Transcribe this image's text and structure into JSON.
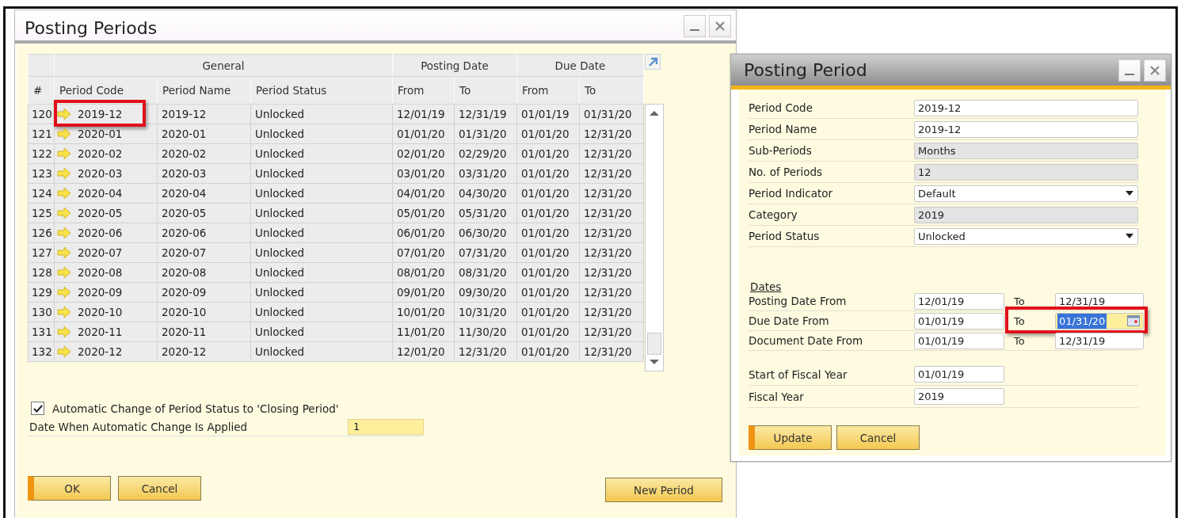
{
  "posting_periods": {
    "title": "Posting Periods",
    "table": {
      "number_column": "#",
      "column_groups": [
        {
          "label": "General",
          "columns": [
            "Period Code",
            "Period Name",
            "Period Status"
          ]
        },
        {
          "label": "Posting Date",
          "columns": [
            "From",
            "To"
          ]
        },
        {
          "label": "Due Date",
          "columns": [
            "From",
            "To"
          ]
        }
      ],
      "rows": [
        {
          "number": "120",
          "cells": [
            "2019-12",
            "2019-12",
            "Unlocked",
            "12/01/19",
            "12/31/19",
            "01/01/19",
            "01/31/20"
          ],
          "highlighted": true
        },
        {
          "number": "121",
          "cells": [
            "2020-01",
            "2020-01",
            "Unlocked",
            "01/01/20",
            "01/31/20",
            "01/01/20",
            "12/31/20"
          ],
          "highlighted": false
        },
        {
          "number": "122",
          "cells": [
            "2020-02",
            "2020-02",
            "Unlocked",
            "02/01/20",
            "02/29/20",
            "01/01/20",
            "12/31/20"
          ],
          "highlighted": false
        },
        {
          "number": "123",
          "cells": [
            "2020-03",
            "2020-03",
            "Unlocked",
            "03/01/20",
            "03/31/20",
            "01/01/20",
            "12/31/20"
          ],
          "highlighted": false
        },
        {
          "number": "124",
          "cells": [
            "2020-04",
            "2020-04",
            "Unlocked",
            "04/01/20",
            "04/30/20",
            "01/01/20",
            "12/31/20"
          ],
          "highlighted": false
        },
        {
          "number": "125",
          "cells": [
            "2020-05",
            "2020-05",
            "Unlocked",
            "05/01/20",
            "05/31/20",
            "01/01/20",
            "12/31/20"
          ],
          "highlighted": false
        },
        {
          "number": "126",
          "cells": [
            "2020-06",
            "2020-06",
            "Unlocked",
            "06/01/20",
            "06/30/20",
            "01/01/20",
            "12/31/20"
          ],
          "highlighted": false
        },
        {
          "number": "127",
          "cells": [
            "2020-07",
            "2020-07",
            "Unlocked",
            "07/01/20",
            "07/31/20",
            "01/01/20",
            "12/31/20"
          ],
          "highlighted": false
        },
        {
          "number": "128",
          "cells": [
            "2020-08",
            "2020-08",
            "Unlocked",
            "08/01/20",
            "08/31/20",
            "01/01/20",
            "12/31/20"
          ],
          "highlighted": false
        },
        {
          "number": "129",
          "cells": [
            "2020-09",
            "2020-09",
            "Unlocked",
            "09/01/20",
            "09/30/20",
            "01/01/20",
            "12/31/20"
          ],
          "highlighted": false
        },
        {
          "number": "130",
          "cells": [
            "2020-10",
            "2020-10",
            "Unlocked",
            "10/01/20",
            "10/31/20",
            "01/01/20",
            "12/31/20"
          ],
          "highlighted": false
        },
        {
          "number": "131",
          "cells": [
            "2020-11",
            "2020-11",
            "Unlocked",
            "11/01/20",
            "11/30/20",
            "01/01/20",
            "12/31/20"
          ],
          "highlighted": false
        },
        {
          "number": "132",
          "cells": [
            "2020-12",
            "2020-12",
            "Unlocked",
            "12/01/20",
            "12/31/20",
            "01/01/20",
            "12/31/20"
          ],
          "highlighted": false
        }
      ]
    },
    "auto_change": {
      "label": "Automatic Change of Period Status to 'Closing Period'",
      "checked": true
    },
    "apply_date": {
      "label": "Date When Automatic Change Is Applied",
      "value": "1"
    },
    "buttons": [
      {
        "label": "OK",
        "default": true
      },
      {
        "label": "Cancel",
        "default": false
      }
    ],
    "side_buttons": [
      {
        "label": "New Period",
        "default": false
      }
    ]
  },
  "posting_period": {
    "title": "Posting Period",
    "fields": [
      {
        "label": "Period Code",
        "value": "2019-12",
        "kind": "text"
      },
      {
        "label": "Period Name",
        "value": "2019-12",
        "kind": "text"
      },
      {
        "label": "Sub-Periods",
        "value": "Months",
        "kind": "readonly"
      },
      {
        "label": "No. of Periods",
        "value": "12",
        "kind": "readonly"
      },
      {
        "label": "Period Indicator",
        "value": "Default",
        "kind": "dropdown"
      },
      {
        "label": "Category",
        "value": "2019",
        "kind": "readonly"
      },
      {
        "label": "Period Status",
        "value": "Unlocked",
        "kind": "dropdown"
      }
    ],
    "dates_heading": "Dates",
    "date_rows": [
      {
        "label": "Posting Date From",
        "from": "12/01/19",
        "to_label": "To",
        "to": "12/31/19",
        "focused": false
      },
      {
        "label": "Due Date From",
        "from": "01/01/19",
        "to_label": "To",
        "to": "01/31/20",
        "focused": true
      },
      {
        "label": "Document Date From",
        "from": "01/01/19",
        "to_label": "To",
        "to": "12/31/19",
        "focused": false
      }
    ],
    "fiscal_fields": [
      {
        "label": "Start of Fiscal Year",
        "value": "01/01/19"
      },
      {
        "label": "Fiscal Year",
        "value": "2019"
      }
    ],
    "buttons": [
      {
        "label": "Update",
        "default": true
      },
      {
        "label": "Cancel",
        "default": false
      }
    ]
  }
}
